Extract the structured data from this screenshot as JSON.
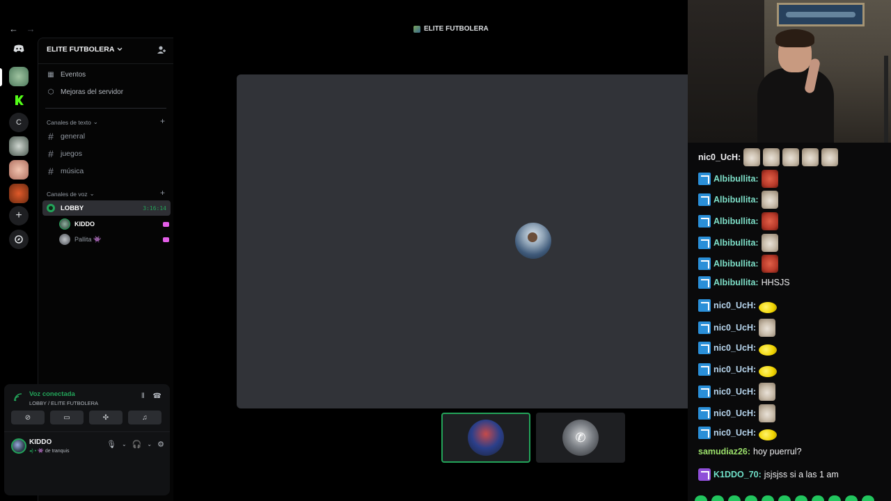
{
  "window": {
    "title": "ELITE FUTBOLERA",
    "back_arrow": "←",
    "forward_arrow": "→"
  },
  "rail": {
    "items": [
      {
        "name": "discord-home",
        "icon": "discord-icon"
      },
      {
        "name": "server-elite-futbolera",
        "icon": "server-avatar"
      },
      {
        "name": "server-k",
        "label": "K"
      },
      {
        "name": "server-c",
        "label": "C"
      },
      {
        "name": "server-4",
        "icon": "server-avatar"
      },
      {
        "name": "server-5",
        "icon": "server-avatar"
      },
      {
        "name": "server-6",
        "icon": "server-avatar"
      },
      {
        "name": "add-server",
        "label": "+"
      },
      {
        "name": "discover",
        "label": "⌀"
      }
    ]
  },
  "sidebar": {
    "server_name": "ELITE FUTBOLERA",
    "menu": [
      {
        "label": "Eventos"
      },
      {
        "label": "Mejoras del servidor"
      }
    ],
    "text_category": "Canales de texto",
    "text_channels": [
      "general",
      "juegos",
      "música"
    ],
    "voice_category": "Canales de voz",
    "voice_channel": {
      "name": "LOBBY",
      "time": "3:16:14"
    },
    "voice_users": [
      {
        "name": "KIDDO"
      },
      {
        "name": "Pallita 👾"
      }
    ]
  },
  "voice_panel": {
    "status": "Voz conectada",
    "location": "LOBBY / ELITE FUTBOLERA",
    "user_name": "KIDDO",
    "user_status": "de tranquis"
  },
  "chat": {
    "messages": [
      {
        "user": "nic0_UcH:",
        "color": "#efeff1",
        "badge": false,
        "emotes": [
          "cat",
          "cat",
          "cat",
          "cat",
          "cat"
        ],
        "text": ""
      },
      {
        "user": "Albibullita:",
        "color": "#7ee0c9",
        "badge": true,
        "emotes": [
          "face"
        ],
        "text": ""
      },
      {
        "user": "Albibullita:",
        "color": "#7ee0c9",
        "badge": true,
        "emotes": [
          "cat"
        ],
        "text": ""
      },
      {
        "user": "Albibullita:",
        "color": "#7ee0c9",
        "badge": true,
        "emotes": [
          "face"
        ],
        "text": ""
      },
      {
        "user": "Albibullita:",
        "color": "#7ee0c9",
        "badge": true,
        "emotes": [
          "cat"
        ],
        "text": ""
      },
      {
        "user": "Albibullita:",
        "color": "#7ee0c9",
        "badge": true,
        "emotes": [
          "face"
        ],
        "text": ""
      },
      {
        "user": "Albibullita:",
        "color": "#7ee0c9",
        "badge": true,
        "emotes": [],
        "text": "HHSJS"
      },
      {
        "user": "nic0_UcH:",
        "color": "#b8d6ee",
        "badge": true,
        "emotes": [
          "duck"
        ],
        "text": ""
      },
      {
        "user": "nic0_UcH:",
        "color": "#b8d6ee",
        "badge": true,
        "emotes": [
          "cat"
        ],
        "text": ""
      },
      {
        "user": "nic0_UcH:",
        "color": "#b8d6ee",
        "badge": true,
        "emotes": [
          "duck"
        ],
        "text": ""
      },
      {
        "user": "nic0_UcH:",
        "color": "#b8d6ee",
        "badge": true,
        "emotes": [
          "duck"
        ],
        "text": ""
      },
      {
        "user": "nic0_UcH:",
        "color": "#b8d6ee",
        "badge": true,
        "emotes": [
          "cat"
        ],
        "text": ""
      },
      {
        "user": "nic0_UcH:",
        "color": "#b8d6ee",
        "badge": true,
        "emotes": [
          "cat"
        ],
        "text": ""
      },
      {
        "user": "nic0_UcH:",
        "color": "#b8d6ee",
        "badge": true,
        "emotes": [
          "duck"
        ],
        "text": ""
      },
      {
        "user": "samudiaz26:",
        "color": "#9be06b",
        "badge": false,
        "emotes": [],
        "text": "hoy puerrul?"
      },
      {
        "user": "K1DDO_70:",
        "color": "#6fe0c9",
        "badge": "mic",
        "emotes": [],
        "text": "jsjsjss si a las 1 am"
      }
    ]
  },
  "colors": {
    "accent_green": "#23a55a",
    "stage_tile": "#313338",
    "sidebar_bg": "#050505"
  }
}
